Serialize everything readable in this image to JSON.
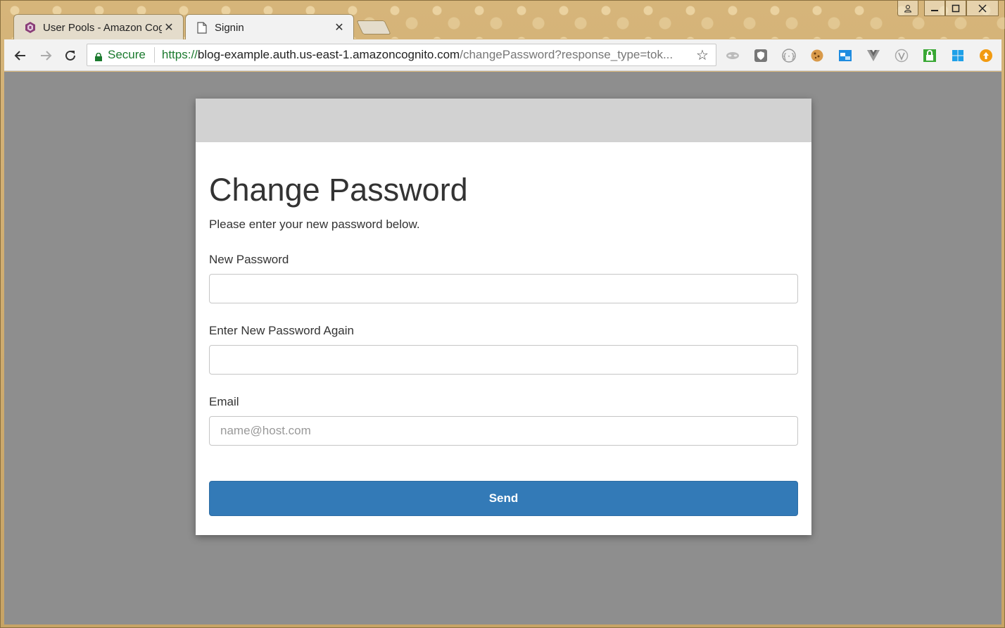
{
  "browser": {
    "tabs": [
      {
        "title": "User Pools - Amazon Cognito",
        "favicon": "cognito-icon",
        "active": false
      },
      {
        "title": "Signin",
        "favicon": "page-icon",
        "active": true
      }
    ],
    "close_glyph": "✕",
    "address_bar": {
      "secure_label": "Secure",
      "url_scheme": "https://",
      "url_host": "blog-example.auth.us-east-1.amazoncognito.com",
      "url_path": "/changePassword?response_type=tok..."
    },
    "extensions": [
      "mask-icon",
      "shield-icon",
      "braces-icon",
      "cookie-icon",
      "window-icon",
      "vue-icon",
      "v-circle-icon",
      "lock-icon",
      "windows-icon",
      "upload-icon"
    ],
    "colors": {
      "secure_green": "#1b7a2e",
      "frame_gold": "#c9a86a"
    }
  },
  "page": {
    "heading": "Change Password",
    "subtext": "Please enter your new password below.",
    "fields": [
      {
        "label": "New Password",
        "value": "",
        "placeholder": ""
      },
      {
        "label": "Enter New Password Again",
        "value": "",
        "placeholder": ""
      },
      {
        "label": "Email",
        "value": "",
        "placeholder": "name@host.com"
      }
    ],
    "submit_label": "Send",
    "colors": {
      "button": "#337ab7",
      "background": "#8e8e8e",
      "banner": "#d2d2d2"
    }
  }
}
